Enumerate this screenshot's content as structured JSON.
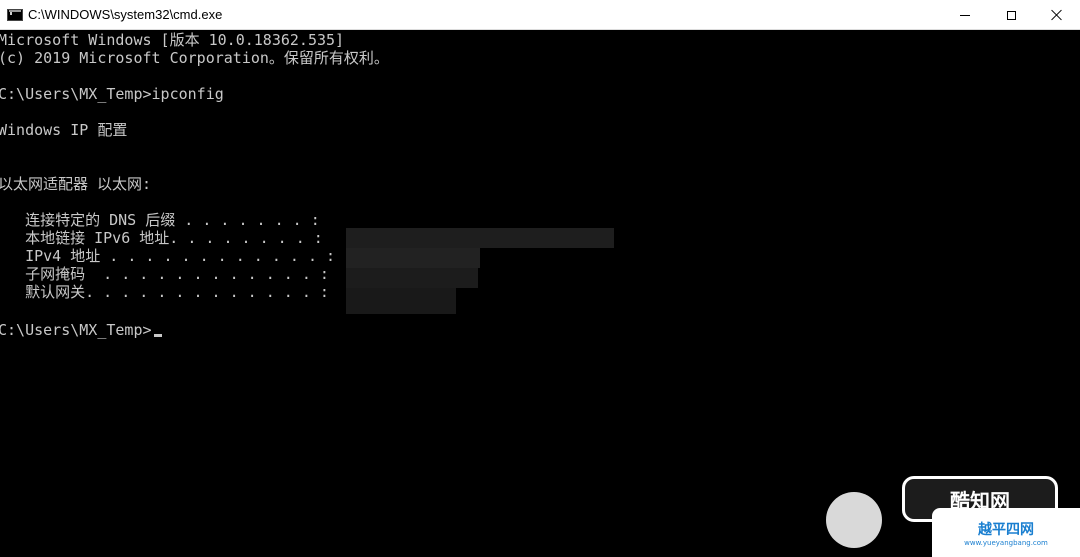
{
  "window": {
    "title": "C:\\WINDOWS\\system32\\cmd.exe"
  },
  "console": {
    "lines": [
      "Microsoft Windows [版本 10.0.18362.535]",
      "(c) 2019 Microsoft Corporation。保留所有权利。",
      "",
      "C:\\Users\\MX_Temp>ipconfig",
      "",
      "Windows IP 配置",
      "",
      "",
      "以太网适配器 以太网:",
      "",
      "   连接特定的 DNS 后缀 . . . . . . . :",
      "   本地链接 IPv6 地址. . . . . . . . :",
      "   IPv4 地址 . . . . . . . . . . . . :",
      "   子网掩码  . . . . . . . . . . . . :",
      "   默认网关. . . . . . . . . . . . . :",
      "",
      "C:\\Users\\MX_Temp>"
    ]
  },
  "watermarks": {
    "badge1": "酷知网",
    "badge2_main": "越平四网",
    "badge2_sub": "www.yueyangbang.com"
  },
  "colors": {
    "console_bg": "#000000",
    "console_text": "#c8c8c8",
    "titlebar_bg": "#ffffff"
  }
}
